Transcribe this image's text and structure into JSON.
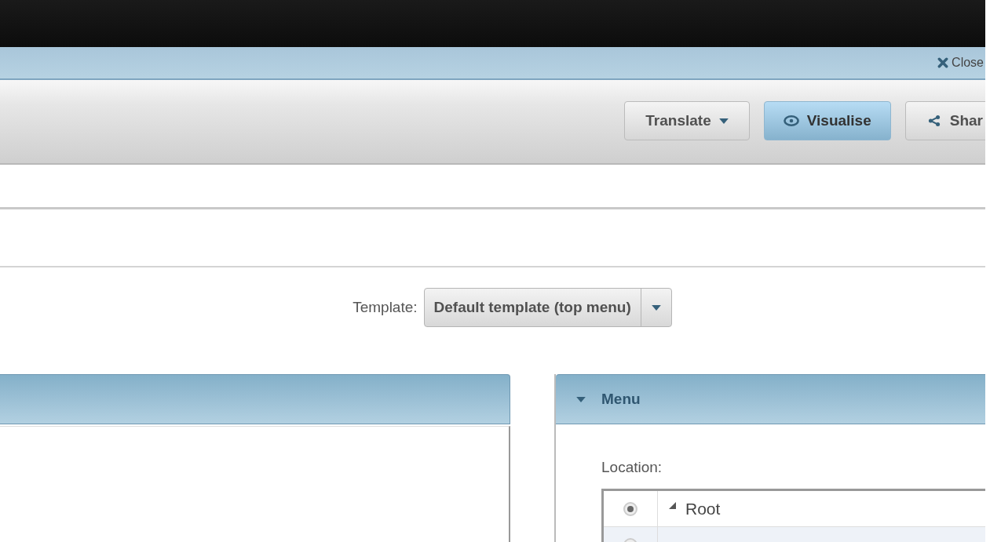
{
  "top_bar": {
    "close_label": "Close"
  },
  "toolbar": {
    "buttons": [
      {
        "label": "Translate",
        "kind": "dropdown",
        "selected": false
      },
      {
        "label": "Visualise",
        "kind": "eye",
        "selected": true
      },
      {
        "label": "Shar",
        "kind": "share",
        "selected": false
      }
    ]
  },
  "template": {
    "label": "Template:",
    "value": "Default template (top menu)"
  },
  "menu_panel": {
    "title": "Menu",
    "expanded": true,
    "location_label": "Location:",
    "rows": [
      {
        "label": "Root",
        "checked": true,
        "expanded": true
      },
      {
        "checked": false
      }
    ]
  }
}
